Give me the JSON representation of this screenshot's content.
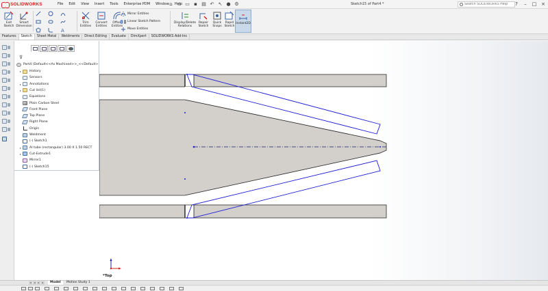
{
  "app": {
    "brand": "SOLIDWORKS",
    "document_title": "Sketch15 of Part4 *",
    "accent_color": "#d0201c"
  },
  "menu": [
    "File",
    "Edit",
    "View",
    "Insert",
    "Tools",
    "Enterprise PDM",
    "Window",
    "Help"
  ],
  "search": {
    "placeholder": "Search SOLIDWORKS Help"
  },
  "ribbon": {
    "exit_sketch": "Exit\nSketch",
    "smart_dimension": "Smart\nDimension",
    "trim_entities": "Trim\nEntities",
    "convert_entities": "Convert\nEntities",
    "offset_entities": "Offset\nEntities",
    "mirror_entities": "Mirror Entities",
    "linear_sketch_pattern": "Linear Sketch Pattern",
    "move_entities": "Move Entities",
    "display_delete_relations": "Display/Delete\nRelations",
    "repair_sketch": "Repair\nSketch",
    "quick_snaps": "Quick\nSnaps",
    "rapid_sketch": "Rapid\nSketch",
    "instant2d": "Instant2D"
  },
  "command_tabs": [
    "Features",
    "Sketch",
    "Sheet Metal",
    "Weldments",
    "Direct Editing",
    "Evaluate",
    "DimXpert",
    "SOLIDWORKS Add-Ins"
  ],
  "active_command_tab": "Sketch",
  "tree": {
    "root": "Part4  (Default<<As Machined>>_<<Default>",
    "items": [
      {
        "label": "History",
        "icon": "folder-icon",
        "arrow": true
      },
      {
        "label": "Sensors",
        "icon": "sensor-icon",
        "arrow": false
      },
      {
        "label": "Annotations",
        "icon": "annotation-icon",
        "arrow": true
      },
      {
        "label": "Cut list(1)",
        "icon": "cut-list-icon",
        "arrow": true
      },
      {
        "label": "Equations",
        "icon": "equation-icon",
        "arrow": false
      },
      {
        "label": "Plain Carbon Steel",
        "icon": "material-icon",
        "arrow": false
      },
      {
        "label": "Front Plane",
        "icon": "plane-icon",
        "arrow": false
      },
      {
        "label": "Top Plane",
        "icon": "plane-icon",
        "arrow": false
      },
      {
        "label": "Right Plane",
        "icon": "plane-icon",
        "arrow": false
      },
      {
        "label": "Origin",
        "icon": "origin-icon",
        "arrow": false
      },
      {
        "label": "Weldment",
        "icon": "weldment-icon",
        "arrow": false
      },
      {
        "label": "(-) Sketch1",
        "icon": "sketch-icon",
        "arrow": false
      },
      {
        "label": "AI tube (rectangular) 3.00 X 1.50 RECT",
        "icon": "structural-member-icon",
        "arrow": true
      },
      {
        "label": "Cut-Extrude1",
        "icon": "cut-extrude-icon",
        "arrow": true
      },
      {
        "label": "Mirror1",
        "icon": "mirror-icon",
        "arrow": false
      },
      {
        "label": "(-) Sketch15",
        "icon": "sketch-icon",
        "arrow": false
      }
    ]
  },
  "view": {
    "label": "*Top"
  },
  "model_tabs": [
    "Model",
    "Motion Study 1"
  ],
  "active_model_tab": "Model",
  "colors": {
    "sketch_line": "#1a1ad6",
    "tube_fill": "#d3d0cc",
    "tube_edge": "#2a2a2a",
    "axis_x": "#d0201c",
    "axis_y": "#1a1ad6"
  }
}
